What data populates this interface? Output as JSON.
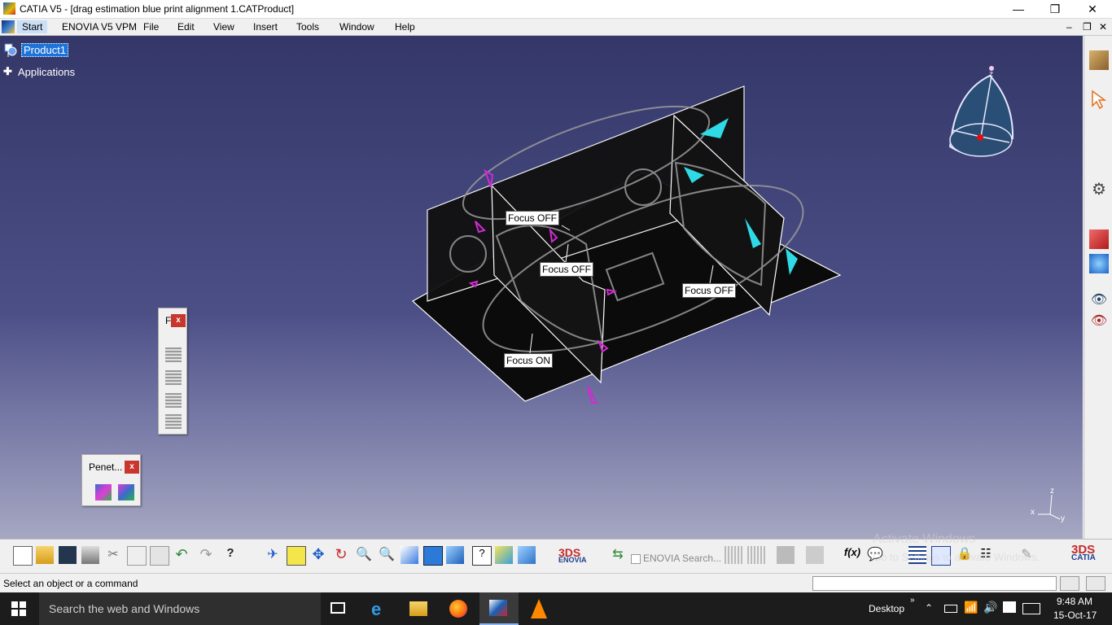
{
  "window": {
    "title": "CATIA V5 - [drag estimation blue print alignment 1.CATProduct]",
    "minimize_glyph": "—",
    "maximize_glyph": "❐",
    "close_glyph": "✕"
  },
  "menubar": {
    "items": [
      "Start",
      "ENOVIA V5 VPM",
      "File",
      "Edit",
      "View",
      "Insert",
      "Tools",
      "Window",
      "Help"
    ],
    "doc_controls": [
      "–",
      "❐",
      "✕"
    ]
  },
  "tree": {
    "root": "Product1",
    "child": "Applications"
  },
  "viewport": {
    "labels": [
      "Focus OFF",
      "Focus OFF",
      "Focus OFF",
      "Focus ON"
    ],
    "compass_axis_z": "z",
    "axis": {
      "z": "z",
      "y": "y",
      "x": "x"
    }
  },
  "panels": {
    "small": {
      "title": "F",
      "close": "x"
    },
    "penetration": {
      "title": "Penet...",
      "close": "x"
    }
  },
  "toolbar_bottom": {
    "enovia_search": "ENOVIA Search...",
    "enovia_logo": "ENOVIA",
    "catia_logo": "CATIA",
    "formula_label": "f(x)"
  },
  "watermark": {
    "line1": "Activate Windows",
    "line2": "Go to Settings to activate Windows."
  },
  "status": {
    "prompt": "Select an object or a command",
    "input_value": ""
  },
  "taskbar": {
    "search_placeholder": "Search the web and Windows",
    "desktop_label": "Desktop",
    "time": "9:48 AM",
    "date": "15-Oct-17"
  },
  "colors": {
    "viewport_top": "#343768",
    "viewport_bottom": "#a6a7c2",
    "selection": "#1e73d8",
    "close_red": "#c8372d",
    "magenta": "#d22ad2",
    "cyan": "#2fd9e6"
  }
}
